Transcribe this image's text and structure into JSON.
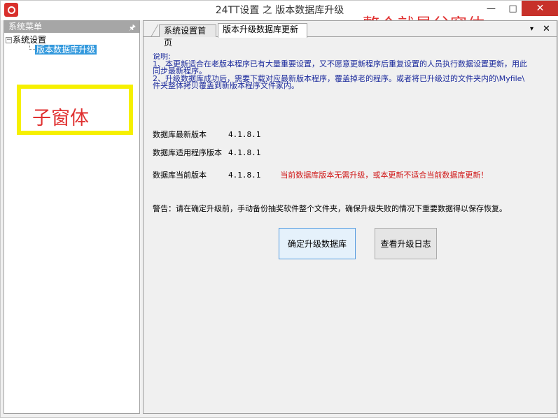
{
  "window": {
    "title": "24TT设置 之 版本数据库升级",
    "annotation_parent": "整个就是父窗体",
    "min_glyph": "—",
    "max_glyph": "□",
    "close_glyph": "✕"
  },
  "left_panel": {
    "header": "系统菜单",
    "pin_glyph": "🖈",
    "tree": {
      "expander": "−",
      "root": "系统设置",
      "child": "版本数据库升级"
    },
    "annotation_child": "子窗体"
  },
  "tabs": [
    {
      "label": "系统设置首页"
    },
    {
      "label": "版本升级数据库更新"
    }
  ],
  "tab_menu_glyph": "▾",
  "tab_close_glyph": "✕",
  "description": {
    "heading": "说明:",
    "line1": "1、本更新适合在老版本程序已有大量重要设置，又不愿意更新程序后重复设置的人员执行数据设置更新，用此",
    "line2": "同步最新程序。",
    "line3": "2、升级数据库成功后，需要下载对应最新版本程序，覆盖掉老的程序。或者将已升级过的文件夹内的\\Myfile\\",
    "line4": "件夹整体拷贝覆盖到新版本程序文件家内。"
  },
  "versions": {
    "latest_label": "数据库最新版本",
    "latest_value": "4.1.8.1",
    "applicable_label": "数据库适用程序版本",
    "applicable_value": "4.1.8.1",
    "current_label": "数据库当前版本",
    "current_value": "4.1.8.1",
    "status_message": "当前数据库版本无需升级，或本更新不适合当前数据库更新！"
  },
  "warning": "警告：请在确定升级前，手动备份抽奖软件整个文件夹，确保升级失败的情况下重要数据得以保存恢复。",
  "buttons": {
    "upgrade": "确定升级数据库",
    "view_log": "查看升级日志"
  }
}
